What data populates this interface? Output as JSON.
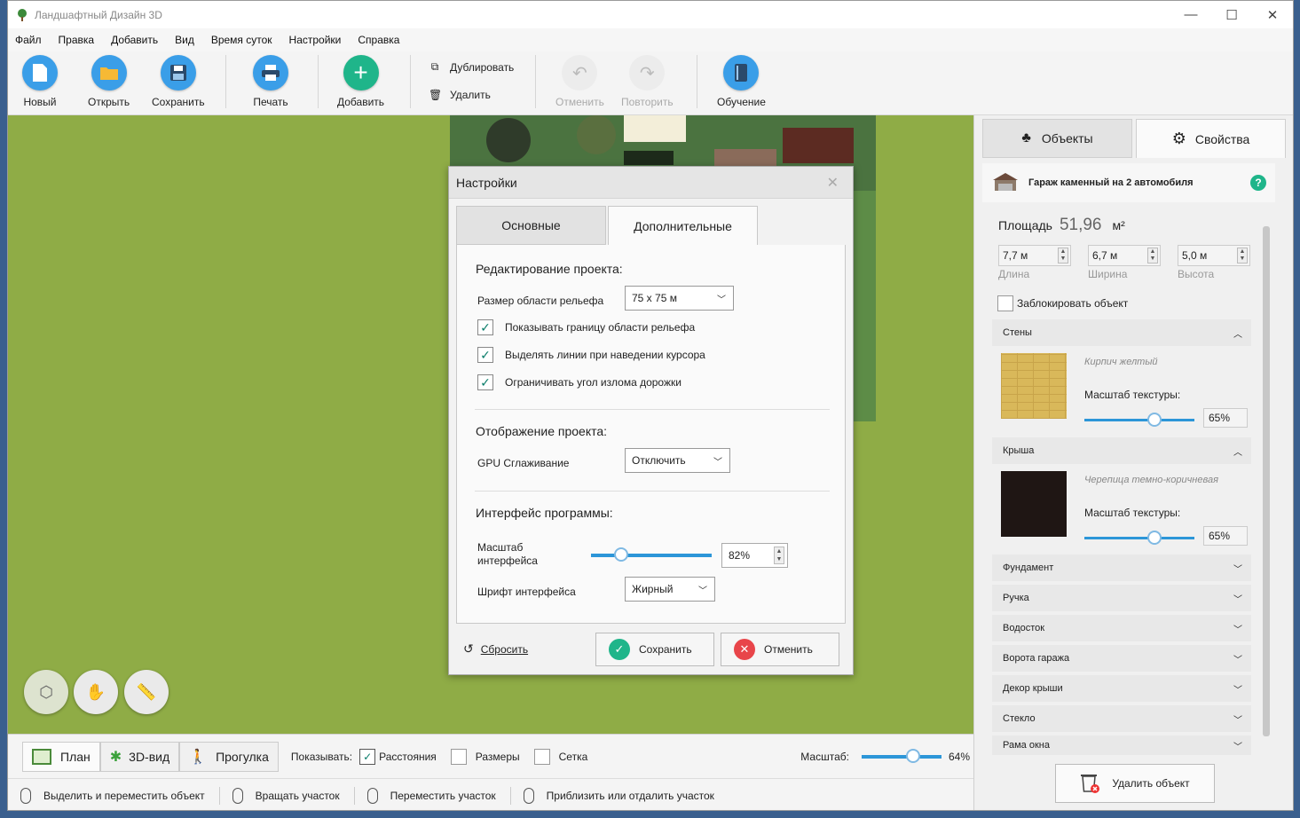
{
  "window": {
    "title": "Ландшафтный Дизайн 3D",
    "controls": {
      "minimize": "—",
      "maximize": "☐",
      "close": "✕"
    }
  },
  "menu": [
    "Файл",
    "Правка",
    "Добавить",
    "Вид",
    "Время суток",
    "Настройки",
    "Справка"
  ],
  "toolbar": {
    "new": "Новый",
    "open": "Открыть",
    "save": "Сохранить",
    "print": "Печать",
    "add": "Добавить",
    "duplicate": "Дублировать",
    "delete": "Удалить",
    "undo": "Отменить",
    "redo": "Повторить",
    "tutorial": "Обучение"
  },
  "right_panel": {
    "tabs": [
      "Объекты",
      "Свойства"
    ],
    "object_name": "Гараж каменный на 2 автомобиля",
    "help": "?",
    "area_label": "Площадь",
    "area_value": "51,96",
    "area_unit": "м²",
    "dims": [
      {
        "value": "7,7  м",
        "caption": "Длина"
      },
      {
        "value": "6,7  м",
        "caption": "Ширина"
      },
      {
        "value": "5,0  м",
        "caption": "Высота"
      }
    ],
    "lock_label": "Заблокировать объект",
    "walls": {
      "title": "Стены",
      "material": "Кирпич желтый",
      "scale_label": "Масштаб текстуры:",
      "scale": "65%",
      "scale_value": 0.65,
      "color": "#d9b85a"
    },
    "roof": {
      "title": "Крыша",
      "material": "Черепица темно-коричневая",
      "scale_label": "Масштаб текстуры:",
      "scale": "65%",
      "scale_value": 0.65,
      "color": "#1f1614"
    },
    "sections": [
      "Фундамент",
      "Ручка",
      "Водосток",
      "Ворота гаража",
      "Декор крыши",
      "Стекло",
      "Рама окна"
    ],
    "delete_button": "Удалить объект"
  },
  "dialog": {
    "title": "Настройки",
    "tabs": [
      "Основные",
      "Дополнительные"
    ],
    "editing_header": "Редактирование проекта:",
    "relief_label": "Размер области рельефа",
    "relief_value": "75 x 75  м",
    "checks": [
      "Показывать границу области рельефа",
      "Выделять линии при наведении курсора",
      "Ограничивать угол излома дорожки"
    ],
    "display_header": "Отображение проекта:",
    "gpu_label": "GPU Сглаживание",
    "gpu_value": "Отключить",
    "interface_header": "Интерфейс программы:",
    "scale_label_1": "Масштаб",
    "scale_label_2": "интерфейса",
    "scale_value": "82%",
    "scale_fraction": 0.25,
    "font_label": "Шрифт интерфейса",
    "font_value": "Жирный",
    "reset": "Сбросить",
    "save": "Сохранить",
    "cancel": "Отменить"
  },
  "bottom": {
    "views": [
      "План",
      "3D-вид",
      "Прогулка"
    ],
    "show_label": "Показывать:",
    "show_distances": "Расстояния",
    "show_sizes": "Размеры",
    "show_grid": "Сетка",
    "zoom_label": "Масштаб:",
    "zoom_value": "64%",
    "zoom_fraction": 0.64
  },
  "status": [
    "Выделить и переместить объект",
    "Вращать участок",
    "Переместить участок",
    "Приблизить или отдалить участок"
  ]
}
